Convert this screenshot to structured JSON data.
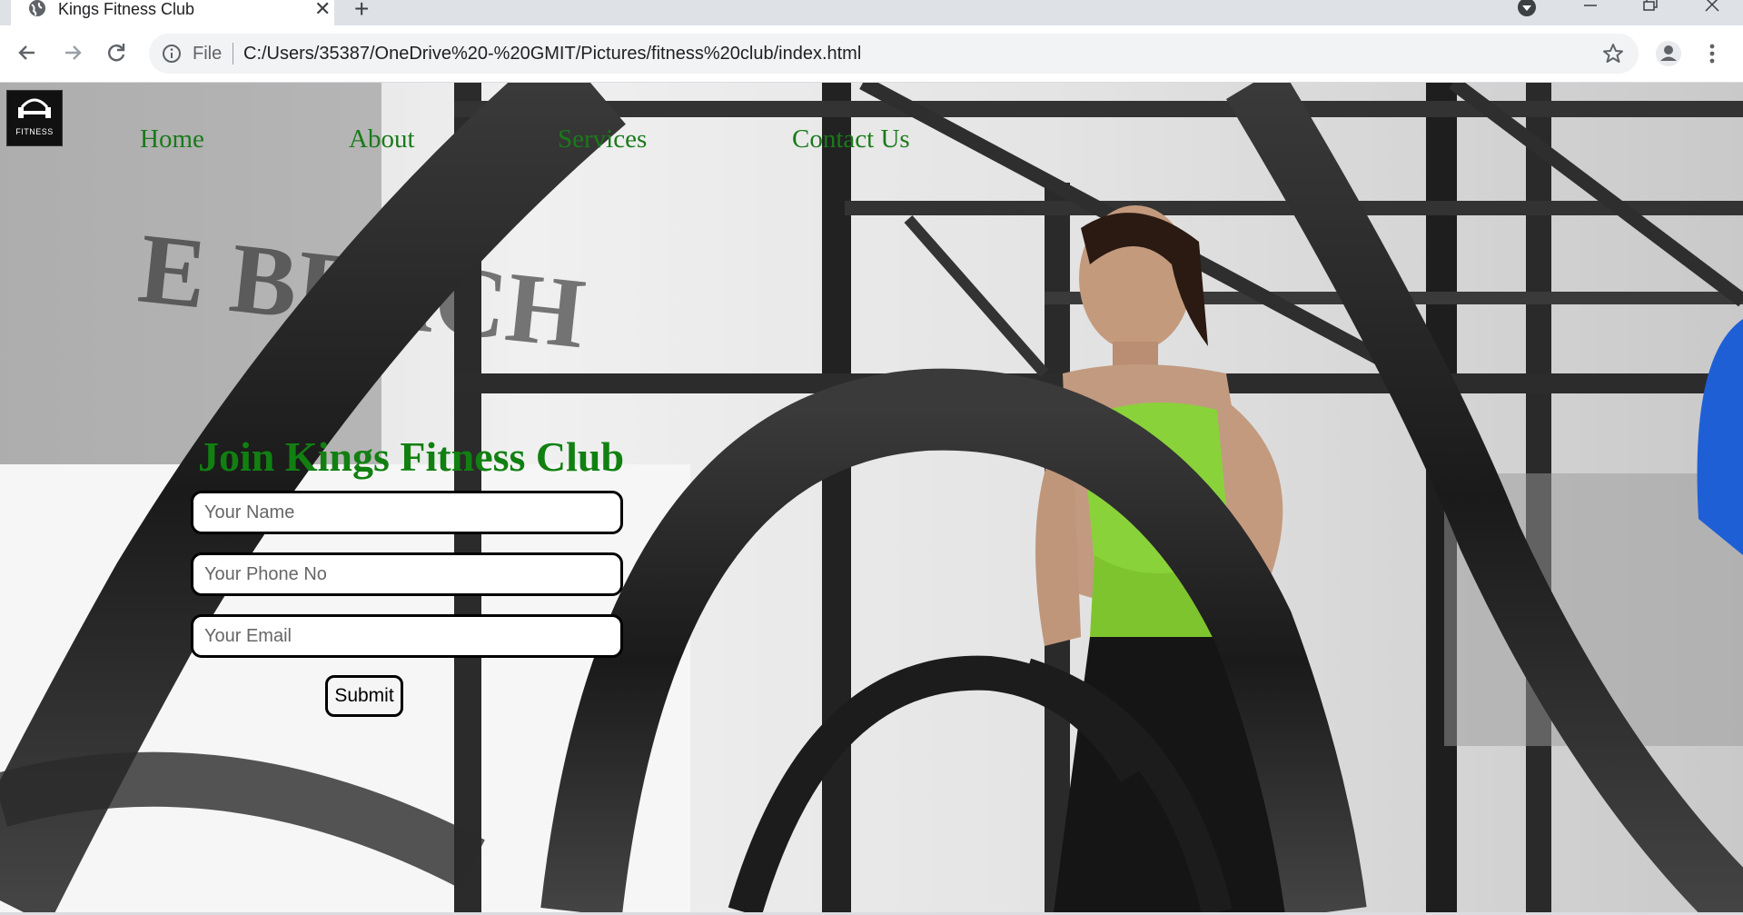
{
  "browser": {
    "tab_title": "Kings Fitness Club",
    "address_scheme_label": "File",
    "url": "C:/Users/35387/OneDrive%20-%20GMIT/Pictures/fitness%20club/index.html"
  },
  "site": {
    "logo_text": "FITNESS",
    "nav": [
      {
        "label": "Home"
      },
      {
        "label": "About"
      },
      {
        "label": "Services"
      },
      {
        "label": "Contact Us"
      }
    ],
    "form": {
      "title": "Join Kings Fitness Club",
      "name_placeholder": "Your Name",
      "phone_placeholder": "Your Phone No",
      "email_placeholder": "Your Email",
      "submit_label": "Submit"
    }
  }
}
